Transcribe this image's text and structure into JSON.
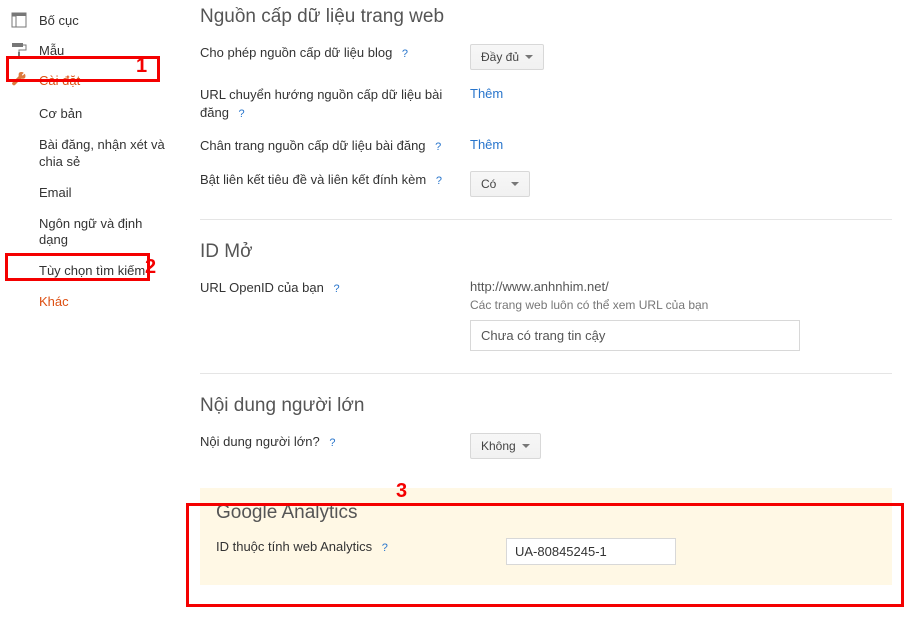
{
  "sidebar": {
    "layout": {
      "label": "Bố cục"
    },
    "template": {
      "label": "Mẫu"
    },
    "settings": {
      "label": "Cài đặt"
    },
    "sub": {
      "basic": "Cơ bản",
      "posts": "Bài đăng, nhận xét và chia sẻ",
      "email": "Email",
      "lang": "Ngôn ngữ và định dạng",
      "search": "Tùy chọn tìm kiếm",
      "other": "Khác"
    }
  },
  "sections": {
    "feed": {
      "title": "Nguồn cấp dữ liệu trang web",
      "allow_label": "Cho phép nguồn cấp dữ liệu blog",
      "allow_value": "Đầy đủ",
      "redirect_label": "URL chuyển hướng nguồn cấp dữ liệu bài đăng",
      "redirect_action": "Thêm",
      "footer_label": "Chân trang nguồn cấp dữ liệu bài đăng",
      "footer_action": "Thêm",
      "titlelinks_label": "Bật liên kết tiêu đề và liên kết đính kèm",
      "titlelinks_value": "Có"
    },
    "openid": {
      "title": "ID Mở",
      "url_label": "URL OpenID của bạn",
      "url_value": "http://www.anhnhim.net/",
      "note": "Các trang web luôn có thể xem URL của bạn",
      "trusted_placeholder": "Chưa có trang tin cậy"
    },
    "adult": {
      "title": "Nội dung người lớn",
      "label": "Nội dung người lớn?",
      "value": "Không"
    },
    "analytics": {
      "title": "Google Analytics",
      "label": "ID thuộc tính web Analytics",
      "value": "UA-80845245-1"
    }
  },
  "help": "?",
  "annot": {
    "n1": "1",
    "n2": "2",
    "n3": "3"
  }
}
